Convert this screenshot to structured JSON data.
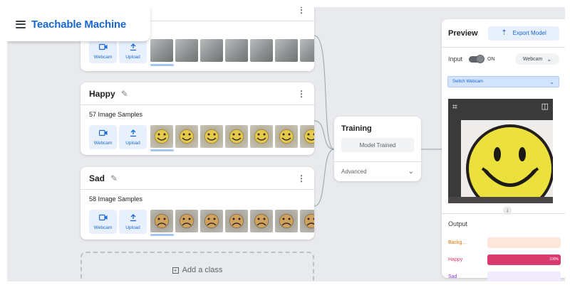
{
  "app": {
    "title": "Teachable Machine"
  },
  "classes": [
    {
      "name": "",
      "samples_label": "",
      "sources": [
        {
          "label": "Webcam",
          "icon": "webcam-icon"
        },
        {
          "label": "Upload",
          "icon": "upload-icon"
        }
      ]
    },
    {
      "name": "Happy",
      "samples_label": "57 Image Samples",
      "sources": [
        {
          "label": "Webcam",
          "icon": "webcam-icon"
        },
        {
          "label": "Upload",
          "icon": "upload-icon"
        }
      ]
    },
    {
      "name": "Sad",
      "samples_label": "58 Image Samples",
      "sources": [
        {
          "label": "Webcam",
          "icon": "webcam-icon"
        },
        {
          "label": "Upload",
          "icon": "upload-icon"
        }
      ]
    }
  ],
  "add_class_label": "Add a class",
  "training": {
    "title": "Training",
    "train_button": "Model Trained",
    "advanced_label": "Advanced"
  },
  "preview": {
    "title": "Preview",
    "export_button": "Export Model",
    "input_label": "Input",
    "toggle_state": "ON",
    "source_select": "Webcam",
    "switch_webcam": "Switch Webcam",
    "output_title": "Output",
    "outputs": [
      {
        "label": "Backg...",
        "color": "#e8710a",
        "track": "#fde7dc",
        "value": 0,
        "value_label": ""
      },
      {
        "label": "Happy",
        "color": "#d93b6e",
        "track": "#fce8ef",
        "value": 1.0,
        "value_label": "100%"
      },
      {
        "label": "Sad",
        "color": "#9334e6",
        "track": "#f1eafd",
        "value": 0,
        "value_label": ""
      }
    ]
  },
  "colors": {
    "accent": "#1967d2",
    "accent_light": "#e8f0fe",
    "canvas": "#e8eaed"
  }
}
